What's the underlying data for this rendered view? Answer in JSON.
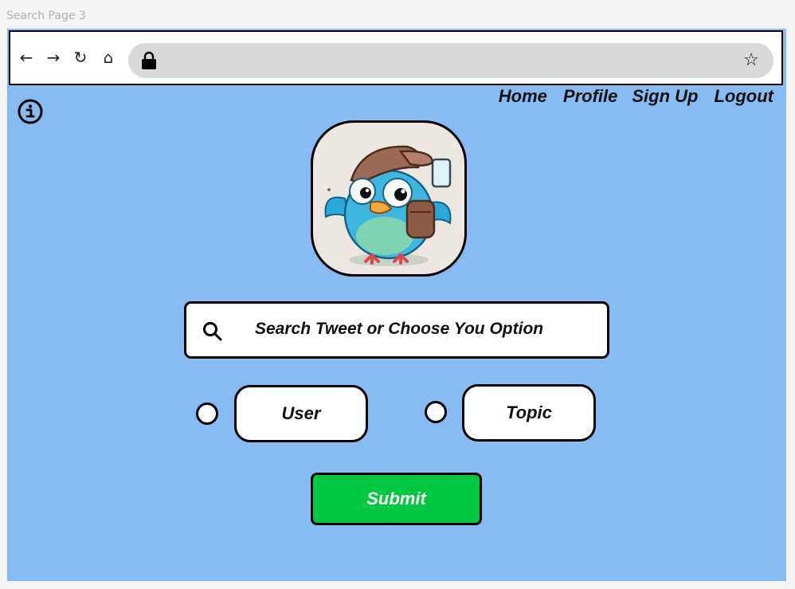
{
  "frame": {
    "label": "Search Page 3"
  },
  "browser": {
    "back_icon": "←",
    "forward_icon": "→",
    "reload_icon": "↻",
    "home_icon": "⌂",
    "star_icon": "☆"
  },
  "nav": {
    "items": [
      {
        "label": "Home"
      },
      {
        "label": "Profile"
      },
      {
        "label": "Sign Up"
      },
      {
        "label": "Logout"
      }
    ]
  },
  "search": {
    "text": "Search Tweet or Choose You Option"
  },
  "options": [
    {
      "label": "User"
    },
    {
      "label": "Topic"
    }
  ],
  "submit": {
    "label": "Submit"
  },
  "colors": {
    "frame_bg": "#86bbf4",
    "submit_bg": "#00c840",
    "address_bar": "#d9d9d9"
  }
}
